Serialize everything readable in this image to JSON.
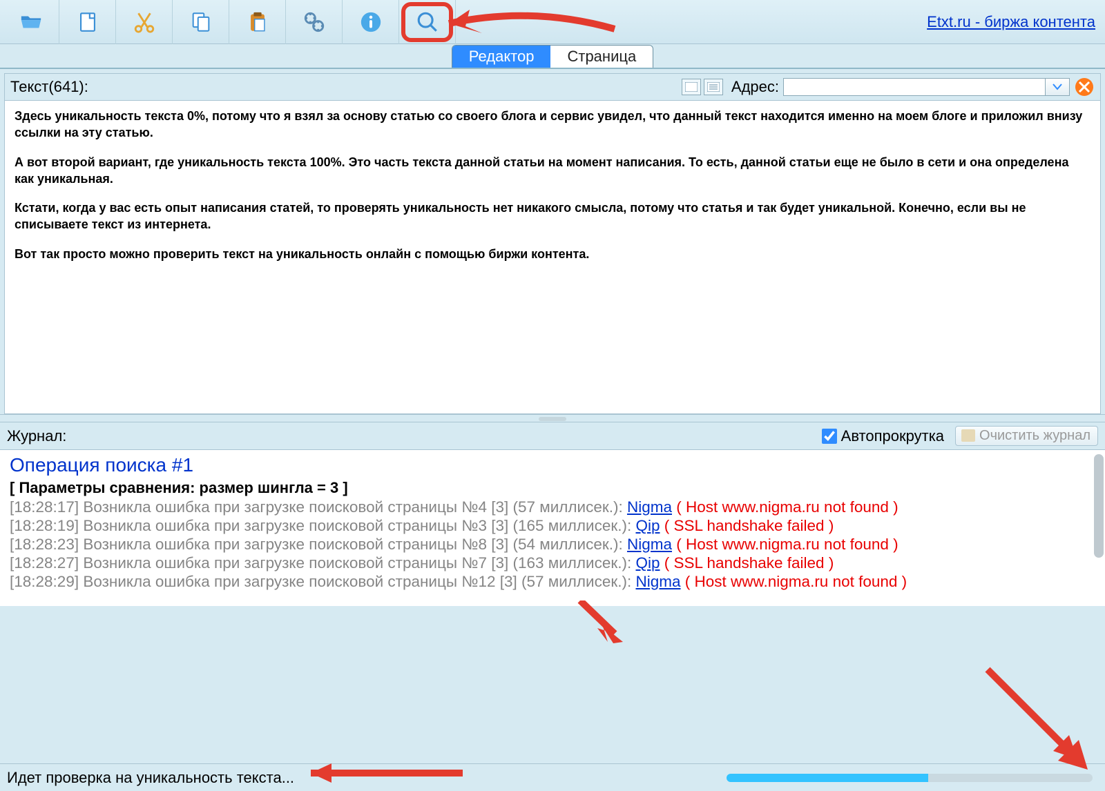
{
  "header_link": "Etxt.ru - биржа контента",
  "tabs": {
    "editor": "Редактор",
    "page": "Страница"
  },
  "text_header": {
    "label": "Текст(641):",
    "addr_label": "Адрес:"
  },
  "body": {
    "p1": "Здесь уникальность текста 0%, потому что я взял за основу статью со своего блога и сервис увидел, что данный текст находится именно на моем блоге и приложил внизу ссылки на эту статью.",
    "p2": "А вот второй вариант, где уникальность текста 100%. Это часть текста данной статьи на момент написания. То есть, данной статьи еще не было в сети и она определена как уникальная.",
    "p3": "Кстати, когда у вас есть опыт написания статей, то проверять уникальность нет никакого смысла, потому что статья и так будет уникальной. Конечно, если вы не списываете текст из интернета.",
    "p4": "Вот так просто можно проверить текст на уникальность онлайн с помощью биржи контента."
  },
  "journal": {
    "title": "Журнал:",
    "autoscroll": "Автопрокрутка",
    "clear": "Очистить журнал",
    "op_title": "Операция поиска #1",
    "params": "[ Параметры сравнения: размер шингла = 3 ]",
    "lines": [
      {
        "ts": "[18:28:17]",
        "msg": "Возникла ошибка при загрузке поисковой страницы №4 [3] (57 миллисек.): ",
        "link": "Nigma",
        "err": " ( Host www.nigma.ru not found )"
      },
      {
        "ts": "[18:28:19]",
        "msg": "Возникла ошибка при загрузке поисковой страницы №3 [3] (165 миллисек.): ",
        "link": "Qip",
        "err": " ( SSL handshake failed )"
      },
      {
        "ts": "[18:28:23]",
        "msg": "Возникла ошибка при загрузке поисковой страницы №8 [3] (54 миллисек.): ",
        "link": "Nigma",
        "err": " ( Host www.nigma.ru not found )"
      },
      {
        "ts": "[18:28:27]",
        "msg": "Возникла ошибка при загрузке поисковой страницы №7 [3] (163 миллисек.): ",
        "link": "Qip",
        "err": " ( SSL handshake failed )"
      },
      {
        "ts": "[18:28:29]",
        "msg": "Возникла ошибка при загрузке поисковой страницы №12 [3] (57 миллисек.): ",
        "link": "Nigma",
        "err": " ( Host www.nigma.ru not found )"
      }
    ]
  },
  "status": {
    "text": "Идет проверка на уникальность текста...",
    "progress_pct": 55
  }
}
